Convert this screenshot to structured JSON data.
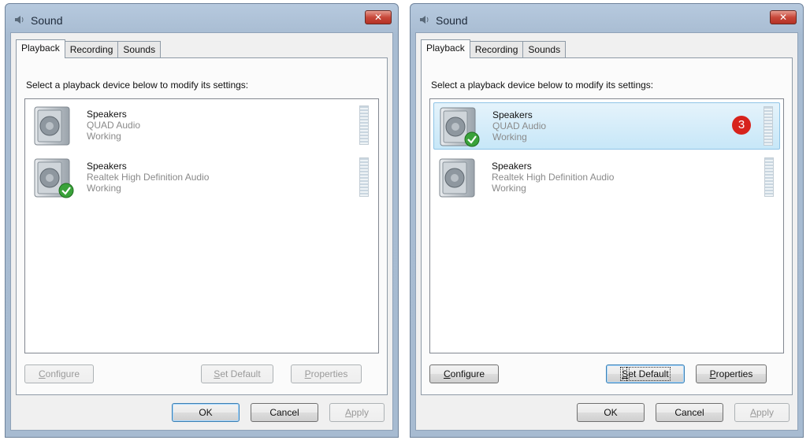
{
  "windows": [
    {
      "title": "Sound",
      "close_label": "✕",
      "tabs": [
        "Playback",
        "Recording",
        "Sounds"
      ],
      "instruction": "Select a playback device below to modify its settings:",
      "devices": [
        {
          "name": "Speakers",
          "driver": "QUAD Audio",
          "status": "Working",
          "is_default": false,
          "selected": false
        },
        {
          "name": "Speakers",
          "driver": "Realtek High Definition Audio",
          "status": "Working",
          "is_default": true,
          "selected": false
        }
      ],
      "buttons": {
        "configure": {
          "pre": "",
          "u": "C",
          "post": "onfigure",
          "enabled": false
        },
        "set_default": {
          "pre": "",
          "u": "S",
          "post": "et Default",
          "enabled": false
        },
        "properties": {
          "pre": "",
          "u": "P",
          "post": "roperties",
          "enabled": false
        },
        "ok": "OK",
        "cancel": "Cancel",
        "apply": {
          "pre": "",
          "u": "A",
          "post": "pply",
          "enabled": false
        }
      }
    },
    {
      "title": "Sound",
      "close_label": "✕",
      "tabs": [
        "Playback",
        "Recording",
        "Sounds"
      ],
      "instruction": "Select a playback device below to modify its settings:",
      "devices": [
        {
          "name": "Speakers",
          "driver": "QUAD Audio",
          "status": "Working",
          "is_default": true,
          "selected": true
        },
        {
          "name": "Speakers",
          "driver": "Realtek High Definition Audio",
          "status": "Working",
          "is_default": false,
          "selected": false
        }
      ],
      "callout": "3",
      "buttons": {
        "configure": {
          "pre": "",
          "u": "C",
          "post": "onfigure",
          "enabled": true
        },
        "set_default": {
          "pre": "",
          "u": "S",
          "post": "et Default",
          "enabled": true
        },
        "properties": {
          "pre": "",
          "u": "P",
          "post": "roperties",
          "enabled": true
        },
        "ok": "OK",
        "cancel": "Cancel",
        "apply": {
          "pre": "",
          "u": "A",
          "post": "pply",
          "enabled": false
        }
      }
    }
  ],
  "colors": {
    "title_bar": "#a8bcd2",
    "close_button": "#c8483a",
    "selection": "#c7e7f8",
    "callout": "#d7231c",
    "default_check": "#3aa23a"
  },
  "icons": {
    "title": "speaker-icon",
    "device": "speaker-device-icon",
    "default_badge": "green-check-icon"
  }
}
